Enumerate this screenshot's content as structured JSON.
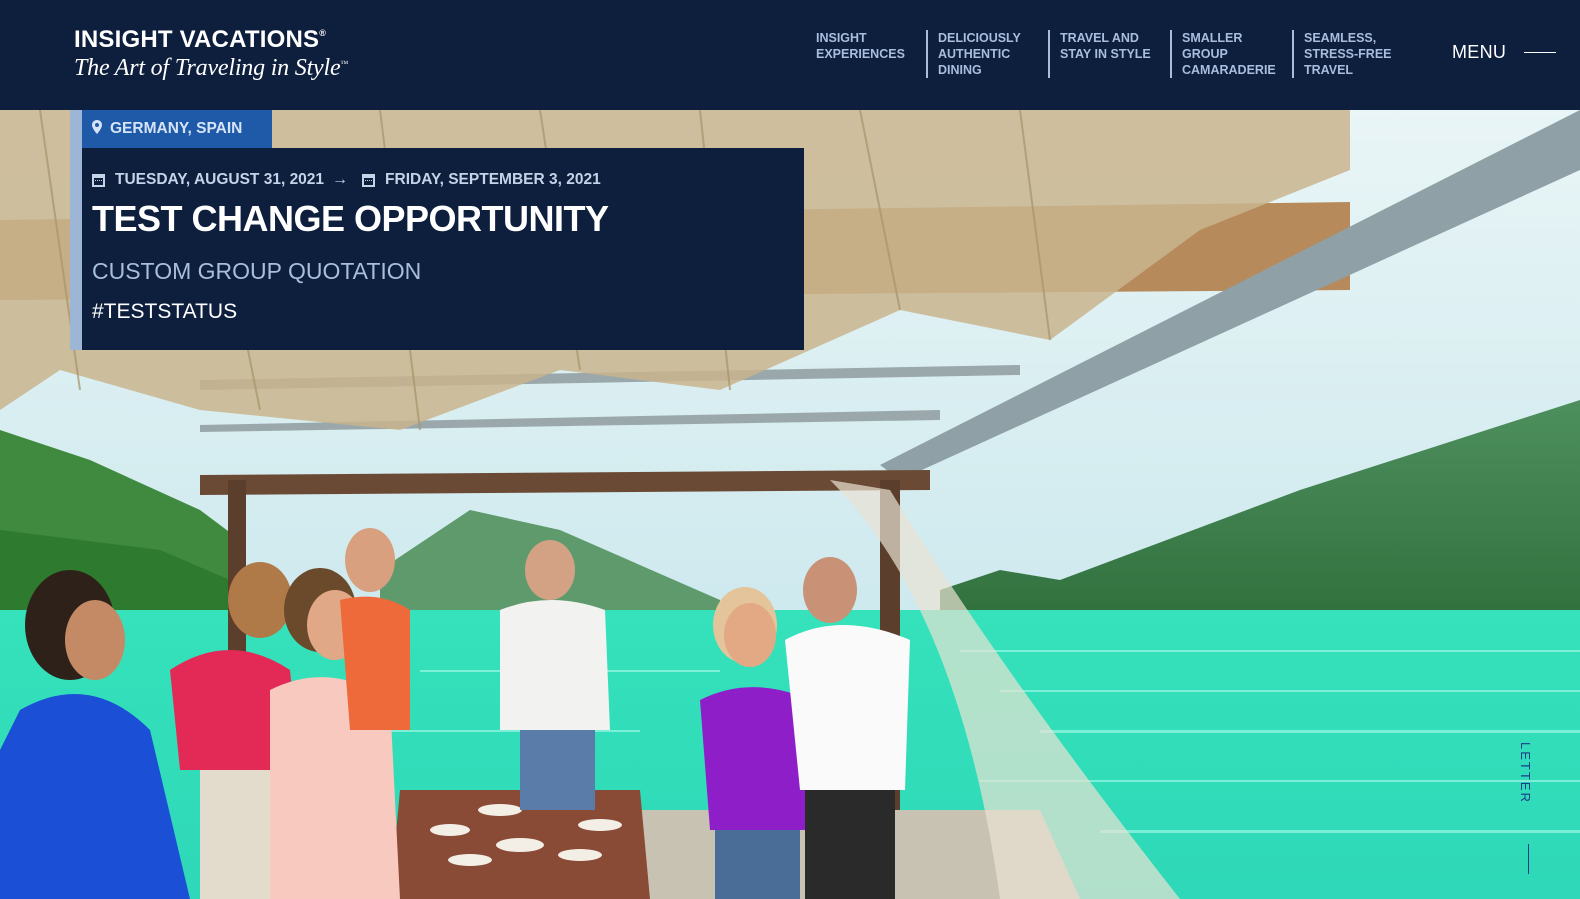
{
  "brand": {
    "name": "INSIGHT VACATIONS",
    "tagline": "The Art of Traveling in Style"
  },
  "nav": {
    "items": [
      {
        "label": "INSIGHT\nEXPERIENCES"
      },
      {
        "label": "DELICIOUSLY\nAUTHENTIC\nDINING"
      },
      {
        "label": "TRAVEL AND\nSTAY IN STYLE"
      },
      {
        "label": "SMALLER\nGROUP\nCAMARADERIE"
      },
      {
        "label": "SEAMLESS,\nSTRESS-FREE\nTRAVEL"
      }
    ],
    "menu_label": "MENU"
  },
  "trip": {
    "location": "GERMANY, SPAIN",
    "start_date": "TUESDAY, AUGUST 31, 2021",
    "end_date": "FRIDAY, SEPTEMBER 3, 2021",
    "title": "TEST CHANGE OPPORTUNITY",
    "subtitle": "CUSTOM GROUP QUOTATION",
    "status": "#TESTSTATUS"
  },
  "side_link": "LETTER",
  "colors": {
    "header_bg": "#0e1f3e",
    "accent_blue": "#1f5aa8",
    "nav_text": "#a9bddc",
    "sea": "#2fe0b4"
  },
  "icons": {
    "location": "map-pin-icon",
    "calendar": "calendar-icon",
    "arrow": "arrow-right-icon"
  }
}
